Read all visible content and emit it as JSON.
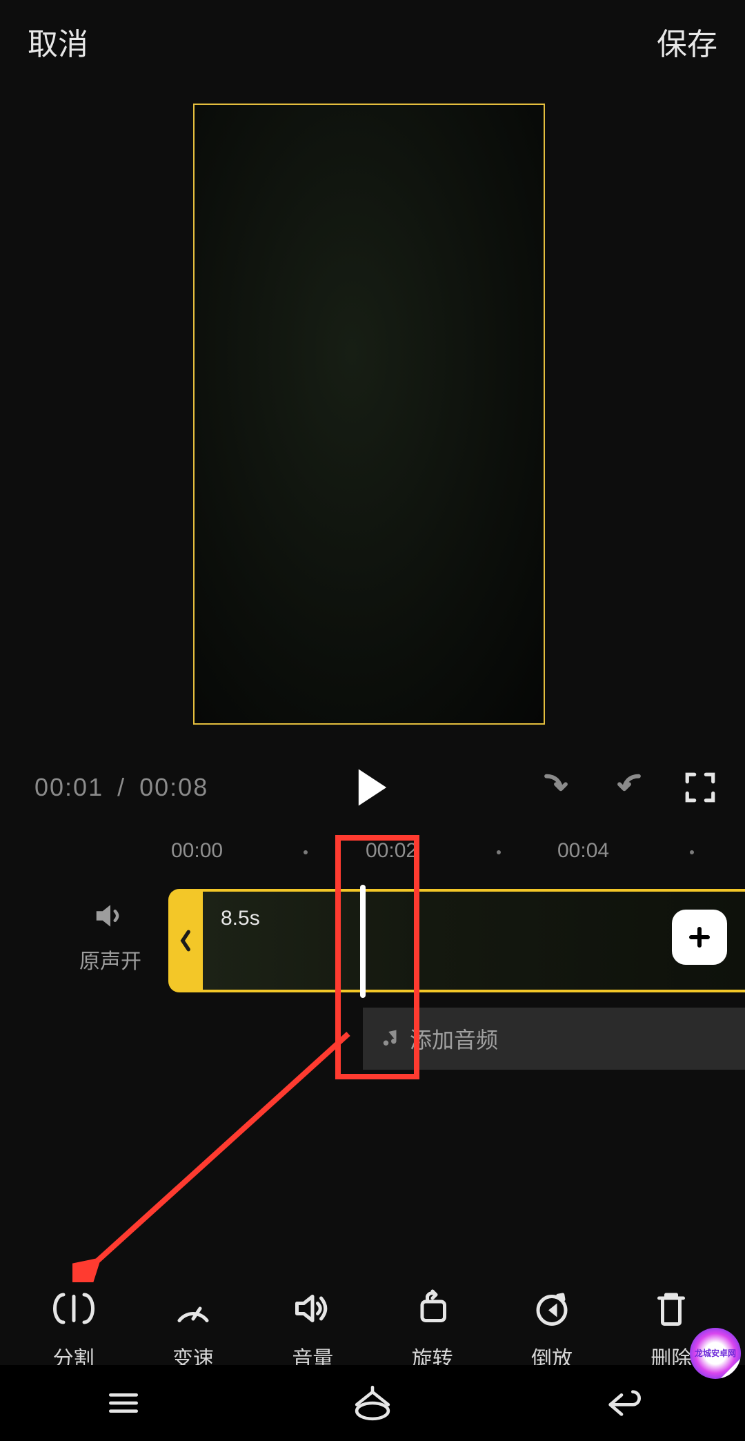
{
  "topbar": {
    "cancel": "取消",
    "save": "保存"
  },
  "playback": {
    "current": "00:01",
    "separator": "/",
    "total": "00:08"
  },
  "ruler": {
    "ticks": [
      "00:00",
      "00:02",
      "00:04"
    ]
  },
  "sound": {
    "label": "原声开"
  },
  "clip": {
    "duration": "8.5s"
  },
  "audio": {
    "add_label": "添加音频"
  },
  "tools": {
    "split": "分割",
    "speed": "变速",
    "volume": "音量",
    "rotate": "旋转",
    "reverse": "倒放",
    "delete": "删除"
  },
  "watermark": {
    "line1": "龙城安卓网"
  },
  "colors": {
    "accent": "#f3c728",
    "annotation": "#ff3b30"
  }
}
